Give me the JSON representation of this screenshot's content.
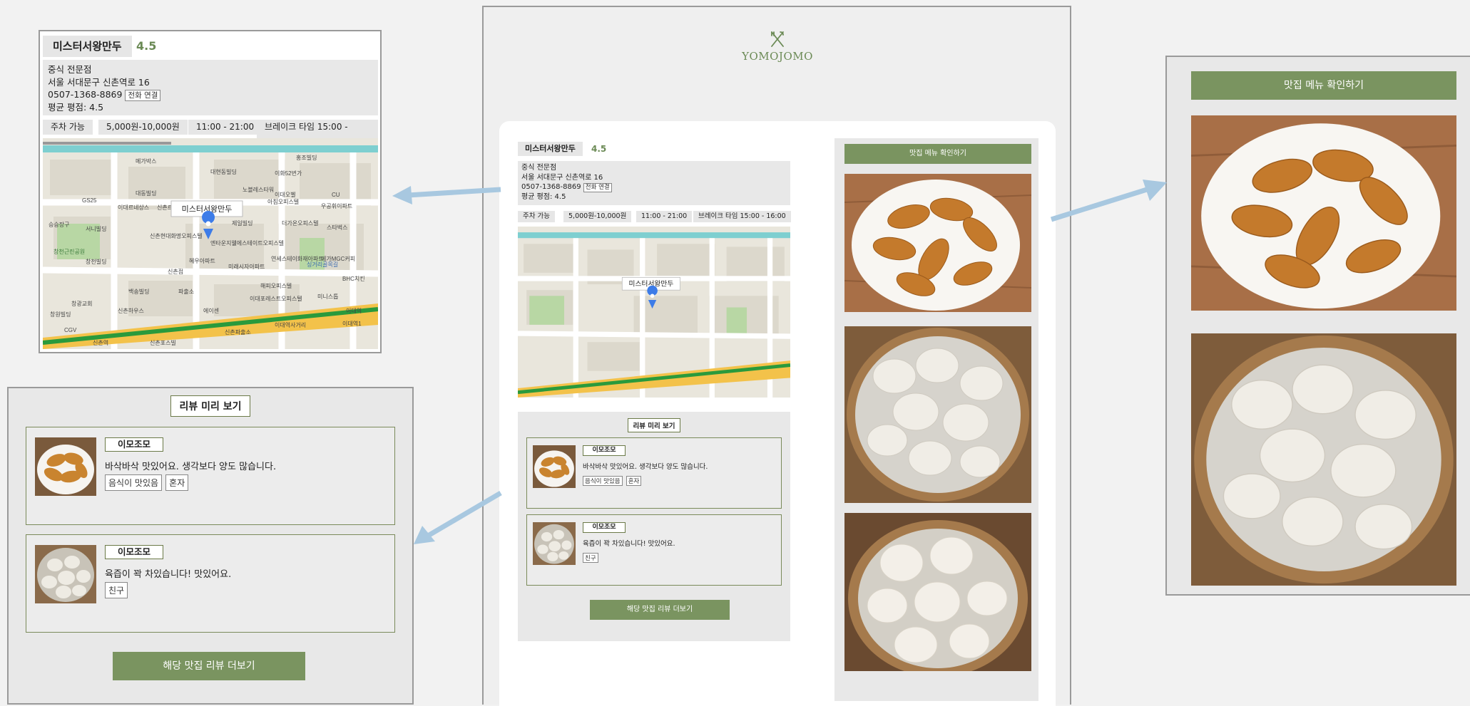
{
  "brand": {
    "name": "YOMOJOMO",
    "accent": "#7a9460"
  },
  "restaurant": {
    "name": "미스터서왕만두",
    "rating": "4.5",
    "category": "중식 전문점",
    "address": "서울 서대문구 신촌역로 16",
    "phone": "0507-1368-8869",
    "call_button": "전화 연결",
    "avg_rating_label": "평균 평점: 4.5",
    "pills": [
      "주차 가능",
      "5,000원-10,000원",
      "11:00 - 21:00",
      "브레이크 타임 15:00 - 16:00"
    ],
    "map_pin_label": "미스터서왕만두"
  },
  "map": {
    "labels": [
      "홍조빌딩",
      "메가박스",
      "대현동빌딩",
      "이화52번가",
      "대동빌딩",
      "노블레스타워",
      "이대오벨",
      "CU",
      "GS25",
      "이대르네상스",
      "신촌르메이에르타운",
      "아침오피스텔",
      "우공휘이파트",
      "승승장구",
      "서니빌딩",
      "제일빌딩",
      "더가온오피스텔",
      "스타벅스",
      "신촌현대화명오피스텔",
      "엔타운지웰에스테이트오피스텔",
      "창천근린공원",
      "창천빌딩",
      "혜우아파트",
      "메가MGC커피",
      "신촌점",
      "미래시자아파트",
      "연세스테이화재아파트",
      "BHC치킨",
      "백송빌딩",
      "파출소",
      "해피오피스텔",
      "창광교회",
      "신촌하우스",
      "이대포레스트오피스텔",
      "미니스톱",
      "창원빌딩",
      "에이센",
      "CGV",
      "신촌역",
      "신촌포스빌",
      "이대역",
      "신촌파출소",
      "이대역사거리",
      "싱거리골목길",
      "이대역1"
    ]
  },
  "menu": {
    "button": "맛집 메뉴 확인하기"
  },
  "reviews": {
    "title": "리뷰 미리 보기",
    "items": [
      {
        "nick": "이모조모",
        "text": "바삭바삭 맛있어요. 생각보다 양도 많습니다.",
        "tags": [
          "음식이 맛있음",
          "혼자"
        ]
      },
      {
        "nick": "이모조모",
        "text": "육즙이 꽉 차있습니다! 맛있어요.",
        "tags": [
          "친구"
        ]
      }
    ],
    "more_button": "해당 맛집 리뷰 더보기"
  }
}
